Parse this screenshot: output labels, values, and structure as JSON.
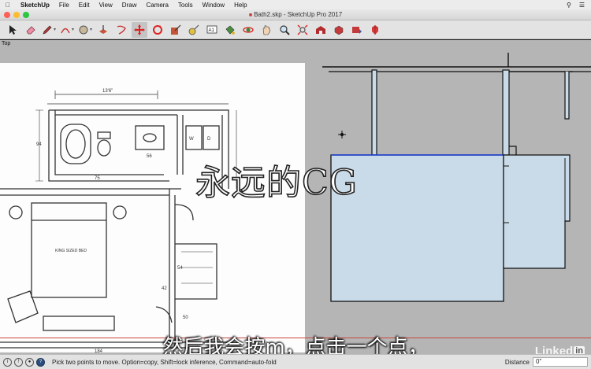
{
  "menubar": {
    "app": "SketchUp",
    "items": [
      "File",
      "Edit",
      "View",
      "Draw",
      "Camera",
      "Tools",
      "Window",
      "Help"
    ]
  },
  "window": {
    "title": "Bath2.skp - SketchUp Pro 2017"
  },
  "toolbar": {
    "tools": [
      "select-icon",
      "eraser-icon",
      "pencil-icon",
      "arc-icon",
      "circle-icon",
      "push-pull-icon",
      "offset-icon",
      "move-icon",
      "rotate-icon",
      "scale-icon",
      "tape-measure-icon",
      "text-icon",
      "paint-bucket-icon",
      "orbit-icon",
      "pan-icon",
      "zoom-icon",
      "zoom-extents-icon",
      "warehouse-icon",
      "extension-icon",
      "extension-2-icon",
      "ruby-icon"
    ],
    "text_tool_label": "A1",
    "active_tool": "move-icon"
  },
  "viewport": {
    "scene_label": "Top"
  },
  "overlay": {
    "watermark": "永远的CG",
    "subtitle": "然后我会按m，点击一个点，",
    "brand": "Linked",
    "brand_in": "in"
  },
  "statusbar": {
    "hint": "Pick two points to move.  Option=copy, Shift=lock inference, Command=auto-fold",
    "measure_label": "Distance",
    "measure_value": "0\""
  },
  "colors": {
    "accent_blue": "#2c4f7f",
    "model_fill": "#c9dbe8",
    "viewport_bg": "#b5b5b5"
  }
}
